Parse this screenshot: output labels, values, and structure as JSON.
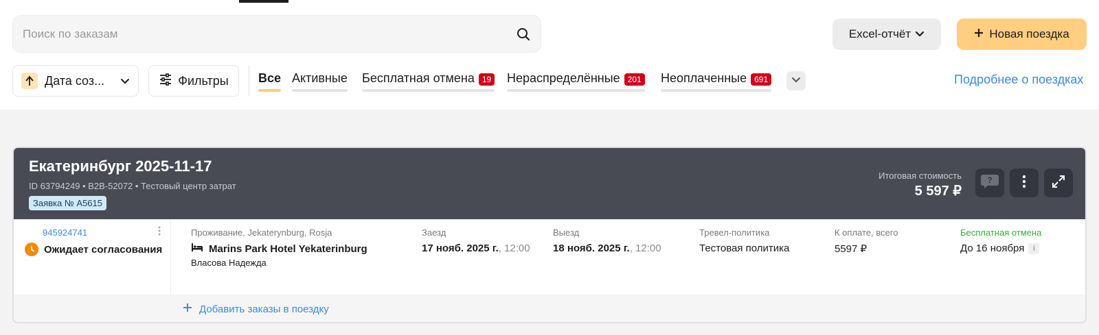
{
  "search": {
    "placeholder": "Поиск по заказам"
  },
  "toolbar": {
    "excel_label": "Excel-отчёт",
    "new_trip_label": "Новая поездка",
    "sort_label": "Дата соз...",
    "filters_label": "Фильтры",
    "more_link": "Подробнее о поездках"
  },
  "tabs": [
    {
      "label": "Все",
      "badge": ""
    },
    {
      "label": "Активные",
      "badge": ""
    },
    {
      "label": "Бесплатная отмена",
      "badge": "19"
    },
    {
      "label": "Нераспределённые",
      "badge": "201"
    },
    {
      "label": "Неоплаченные",
      "badge": "691"
    }
  ],
  "trip": {
    "title": "Екатеринбург 2025-11-17",
    "subtitle": "ID 63794249 • B2B-52072 • Тестовый центр затрат",
    "request_badge": "Заявка № A5615",
    "total_label": "Итоговая стоимость",
    "total_value": "5 597 ₽",
    "add_orders_label": "Добавить заказы в поездку"
  },
  "order": {
    "id": "945924741",
    "status": "Ожидает согласования",
    "accommodation_label": "Проживание, Jekaterynburg, Rosja",
    "hotel_name": "Marins Park Hotel Yekaterinburg",
    "guest": "Власова Надежда",
    "checkin_label": "Заезд",
    "checkin_date": "17 нояб. 2025 г.",
    "checkin_time": ", 12:00",
    "checkout_label": "Выезд",
    "checkout_date": "18 нояб. 2025 г.",
    "checkout_time": ", 12:00",
    "policy_label": "Тревел-политика",
    "policy_value": "Тестовая политика",
    "payment_label": "К оплате, всего",
    "payment_value": "5597 ₽",
    "cancel_label": "Бесплатная отмена",
    "cancel_value": "До 16 ноября",
    "info_glyph": "i"
  },
  "colors": {
    "accent": "#ffce80",
    "link": "#3a8bdc",
    "badge": "#d0021b",
    "header_dark": "#484b53",
    "status_pending": "#f08a00",
    "free_cancel": "#3caa3c"
  }
}
